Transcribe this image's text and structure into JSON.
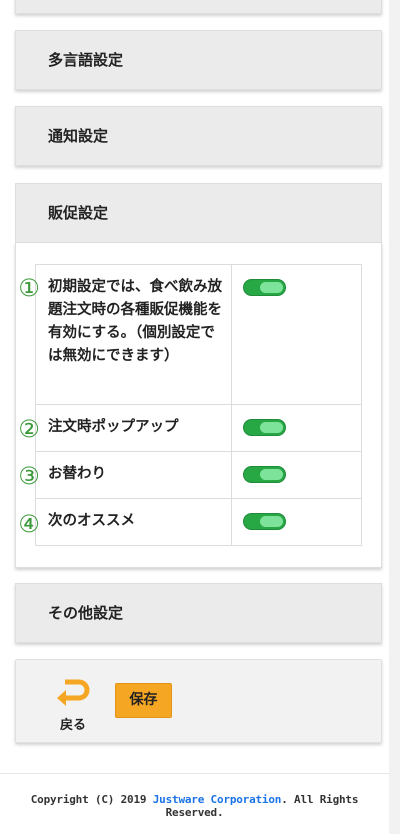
{
  "sections": {
    "multilang": "多言語設定",
    "notification": "通知設定",
    "promotion": "販促設定",
    "other": "その他設定"
  },
  "promotion_settings": [
    {
      "marker": "①",
      "label": "初期設定では、食べ飲み放題注文時の各種販促機能を有効にする。（個別設定では無効にできます）",
      "enabled": true
    },
    {
      "marker": "②",
      "label": "注文時ポップアップ",
      "enabled": true
    },
    {
      "marker": "③",
      "label": "お替わり",
      "enabled": true
    },
    {
      "marker": "④",
      "label": "次のオススメ",
      "enabled": true
    }
  ],
  "actions": {
    "back_label": "戻る",
    "save_label": "保存"
  },
  "footer": {
    "prefix": "Copyright (C) 2019 ",
    "company": "Justware Corporation",
    "suffix": ". All Rights Reserved."
  },
  "colors": {
    "toggle_on": "#28a745",
    "save_button": "#f5a623",
    "back_icon": "#f5a623",
    "marker": "#3a9a3a",
    "link": "#1a73e8"
  }
}
